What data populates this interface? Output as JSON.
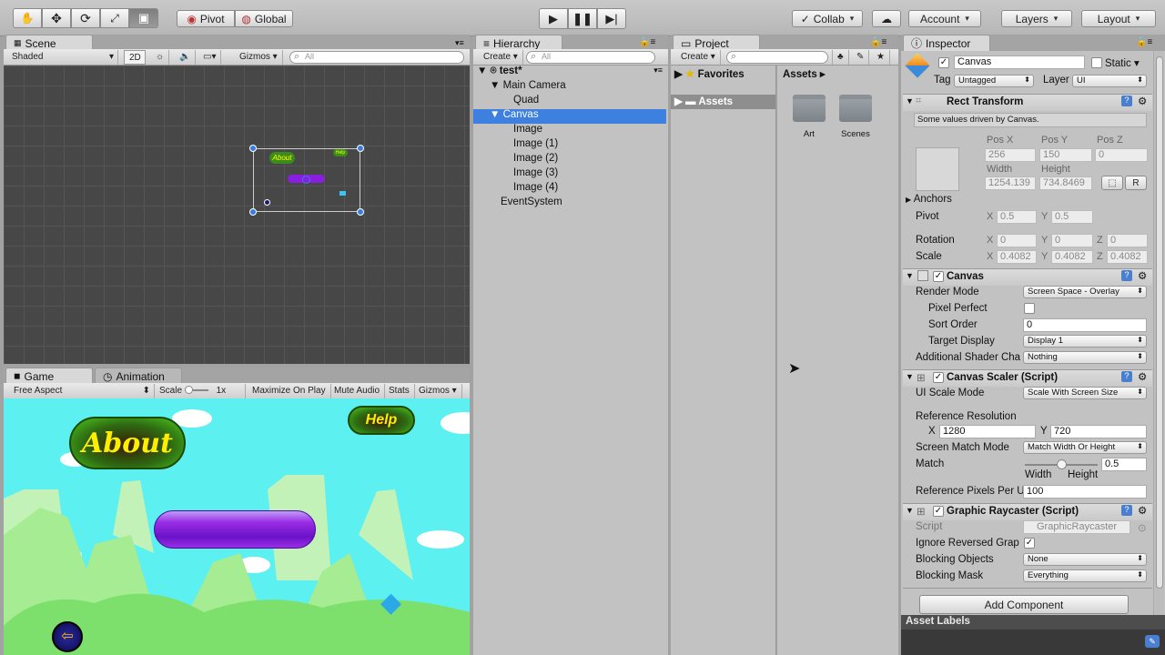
{
  "toolbar": {
    "pivot": "Pivot",
    "global": "Global",
    "collab": "Collab",
    "account": "Account",
    "layers": "Layers",
    "layout": "Layout"
  },
  "scene": {
    "tab": "Scene",
    "shaded": "Shaded",
    "mode2d": "2D",
    "gizmos": "Gizmos",
    "search_placeholder": "All",
    "about": "About",
    "help": "Help"
  },
  "game": {
    "tab": "Game",
    "animation_tab": "Animation",
    "aspect": "Free Aspect",
    "scale_label": "Scale",
    "scale_value": "1x",
    "maximize": "Maximize On Play",
    "mute": "Mute Audio",
    "stats": "Stats",
    "gizmos": "Gizmos",
    "about": "About",
    "help": "Help"
  },
  "hierarchy": {
    "tab": "Hierarchy",
    "create": "Create",
    "search_placeholder": "All",
    "items": [
      "test*",
      "Main Camera",
      "Quad",
      "Canvas",
      "Image",
      "Image (1)",
      "Image (2)",
      "Image (3)",
      "Image (4)",
      "EventSystem"
    ]
  },
  "project": {
    "tab": "Project",
    "create": "Create",
    "favorites": "Favorites",
    "assets": "Assets",
    "breadcrumb": "Assets",
    "folders": [
      "Art",
      "Scenes"
    ]
  },
  "inspector": {
    "tab": "Inspector",
    "object_name": "Canvas",
    "static": "Static",
    "tag_label": "Tag",
    "tag": "Untagged",
    "layer_label": "Layer",
    "layer": "UI",
    "rect": {
      "title": "Rect Transform",
      "note": "Some values driven by Canvas.",
      "posx_label": "Pos X",
      "posy_label": "Pos Y",
      "posz_label": "Pos Z",
      "posx": "256",
      "posy": "150",
      "posz": "0",
      "width_label": "Width",
      "height_label": "Height",
      "width": "1254.139",
      "height": "734.8469",
      "r": "R",
      "anchors": "Anchors",
      "pivot": "Pivot",
      "pivot_x": "0.5",
      "pivot_y": "0.5",
      "rotation": "Rotation",
      "rot_x": "0",
      "rot_y": "0",
      "rot_z": "0",
      "scale": "Scale",
      "scale_x": "0.4082",
      "scale_y": "0.4082",
      "scale_z": "0.4082",
      "x": "X",
      "y": "Y",
      "z": "Z"
    },
    "canvas": {
      "title": "Canvas",
      "render_mode_label": "Render Mode",
      "render_mode": "Screen Space - Overlay",
      "pixel_perfect": "Pixel Perfect",
      "sort_order_label": "Sort Order",
      "sort_order": "0",
      "target_display_label": "Target Display",
      "target_display": "Display 1",
      "additional_label": "Additional Shader Cha",
      "additional": "Nothing"
    },
    "scaler": {
      "title": "Canvas Scaler (Script)",
      "ui_scale_label": "UI Scale Mode",
      "ui_scale": "Scale With Screen Size",
      "ref_res_label": "Reference Resolution",
      "ref_x": "1280",
      "ref_y": "720",
      "match_mode_label": "Screen Match Mode",
      "match_mode": "Match Width Or Height",
      "match_label": "Match",
      "match_value": "0.5",
      "match_fraction": 0.5,
      "width_word": "Width",
      "height_word": "Height",
      "ppu_label": "Reference Pixels Per U",
      "ppu": "100"
    },
    "raycaster": {
      "title": "Graphic Raycaster (Script)",
      "script_label": "Script",
      "script": "GraphicRaycaster",
      "ignore_label": "Ignore Reversed Grap",
      "blocking_objects_label": "Blocking Objects",
      "blocking_objects": "None",
      "blocking_mask_label": "Blocking Mask",
      "blocking_mask": "Everything"
    },
    "add_component": "Add Component",
    "asset_labels": "Asset Labels"
  }
}
